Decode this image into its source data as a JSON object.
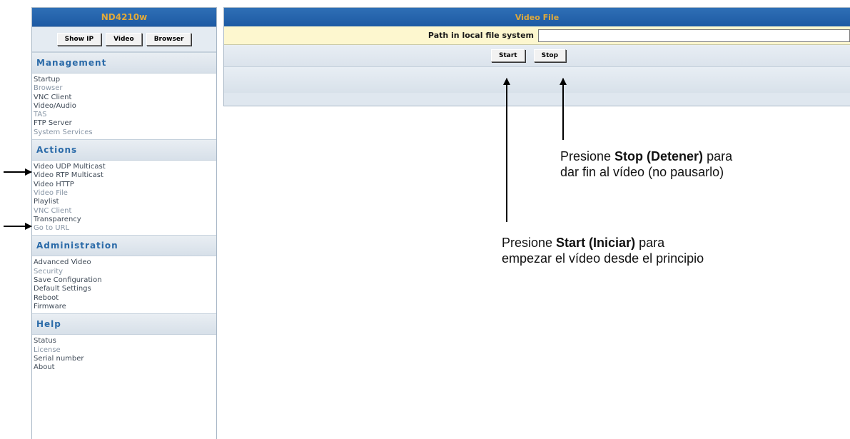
{
  "sidebar": {
    "title": "ND4210w",
    "buttons": [
      "Show IP",
      "Video",
      "Browser"
    ],
    "sections": [
      {
        "title": "Management",
        "items": [
          {
            "label": "Startup",
            "tone": "dark"
          },
          {
            "label": "Browser",
            "tone": "light"
          },
          {
            "label": "VNC Client",
            "tone": "dark"
          },
          {
            "label": "Video/Audio",
            "tone": "dark"
          },
          {
            "label": "TAS",
            "tone": "light"
          },
          {
            "label": "FTP Server",
            "tone": "dark"
          },
          {
            "label": "System Services",
            "tone": "light"
          }
        ]
      },
      {
        "title": "Actions",
        "items": [
          {
            "label": "Video UDP Multicast",
            "tone": "dark"
          },
          {
            "label": "Video RTP Multicast",
            "tone": "dark"
          },
          {
            "label": "Video HTTP",
            "tone": "dark"
          },
          {
            "label": "Video File",
            "tone": "light"
          },
          {
            "label": "Playlist",
            "tone": "dark"
          },
          {
            "label": "VNC Client",
            "tone": "light"
          },
          {
            "label": "Transparency",
            "tone": "dark"
          },
          {
            "label": "Go to URL",
            "tone": "light"
          }
        ]
      },
      {
        "title": "Administration",
        "items": [
          {
            "label": "Advanced Video",
            "tone": "dark"
          },
          {
            "label": "Security",
            "tone": "light"
          },
          {
            "label": "Save Configuration",
            "tone": "dark"
          },
          {
            "label": "Default Settings",
            "tone": "dark"
          },
          {
            "label": "Reboot",
            "tone": "dark"
          },
          {
            "label": "Firmware",
            "tone": "dark"
          }
        ]
      },
      {
        "title": "Help",
        "items": [
          {
            "label": "Status",
            "tone": "dark"
          },
          {
            "label": "License",
            "tone": "light"
          },
          {
            "label": "Serial number",
            "tone": "dark"
          },
          {
            "label": "About",
            "tone": "dark"
          }
        ]
      }
    ]
  },
  "main": {
    "title": "Video File",
    "path_label": "Path in local file system",
    "path_value": "",
    "start_label": "Start",
    "stop_label": "Stop"
  },
  "annotations": {
    "stop_prefix": "Presione ",
    "stop_bold": "Stop (Detener)",
    "stop_suffix": " para",
    "stop_line2": "dar fin al vídeo (no pausarlo)",
    "start_prefix": "Presione ",
    "start_bold": "Start (Iniciar)",
    "start_suffix": " para",
    "start_line2": "empezar el vídeo desde el principio"
  },
  "colors": {
    "header_blue": "#1d5aa3",
    "header_text": "#e0a93a",
    "section_text": "#2a6aa8",
    "path_row_bg": "#fdf7cf"
  }
}
